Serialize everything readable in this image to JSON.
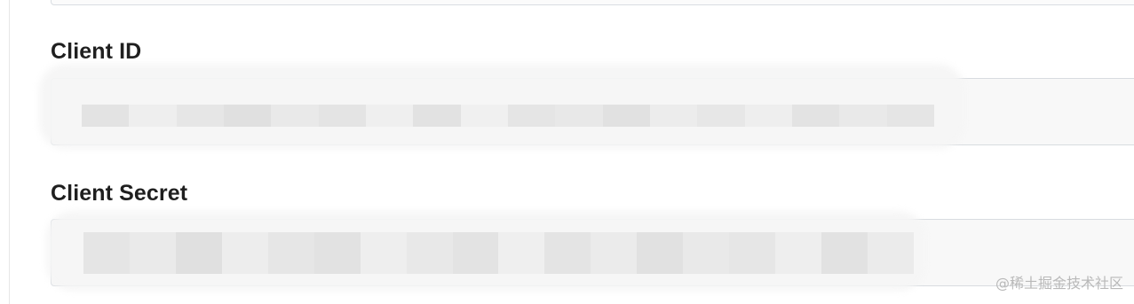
{
  "form": {
    "client_id": {
      "label": "Client ID",
      "value": ""
    },
    "client_secret": {
      "label": "Client Secret",
      "value": ""
    }
  },
  "watermark": "@稀土掘金技术社区",
  "colors": {
    "label_text": "#1f1f1f",
    "field_border": "#d8dce0",
    "field_background": "#f8f8f8",
    "redaction_light": "#ececec",
    "redaction_dark": "#e1e1e1",
    "watermark_text": "#b9b9b9"
  }
}
